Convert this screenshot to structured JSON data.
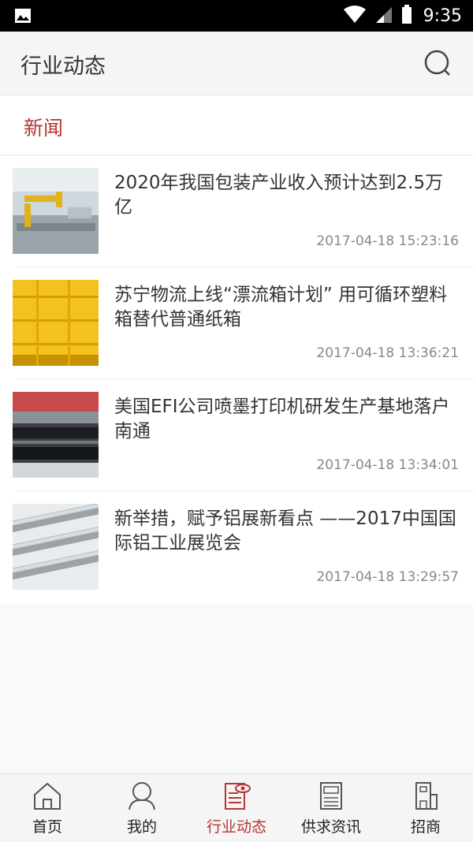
{
  "status_bar": {
    "time": "9:35"
  },
  "header": {
    "title": "行业动态"
  },
  "section": {
    "label": "新闻"
  },
  "news": [
    {
      "title": "2020年我国包装产业收入预计达到2.5万亿",
      "time": "2017-04-18 15:23:16"
    },
    {
      "title": "苏宁物流上线“漂流箱计划” 用可循环塑料箱替代普通纸箱",
      "time": "2017-04-18 13:36:21"
    },
    {
      "title": "美国EFI公司喷墨打印机研发生产基地落户南通",
      "time": "2017-04-18 13:34:01"
    },
    {
      "title": "新举措，赋予铝展新看点 ——2017中国国际铝工业展览会",
      "time": "2017-04-18 13:29:57"
    }
  ],
  "tabs": [
    {
      "label": "首页",
      "icon": "home-icon"
    },
    {
      "label": "我的",
      "icon": "user-icon"
    },
    {
      "label": "行业动态",
      "icon": "news-eye-icon",
      "active": true
    },
    {
      "label": "供求资讯",
      "icon": "supply-demand-icon"
    },
    {
      "label": "招商",
      "icon": "building-icon"
    }
  ],
  "colors": {
    "accent": "#b53636",
    "text": "#333333",
    "muted": "#888888",
    "background": "#f9f9f9"
  }
}
